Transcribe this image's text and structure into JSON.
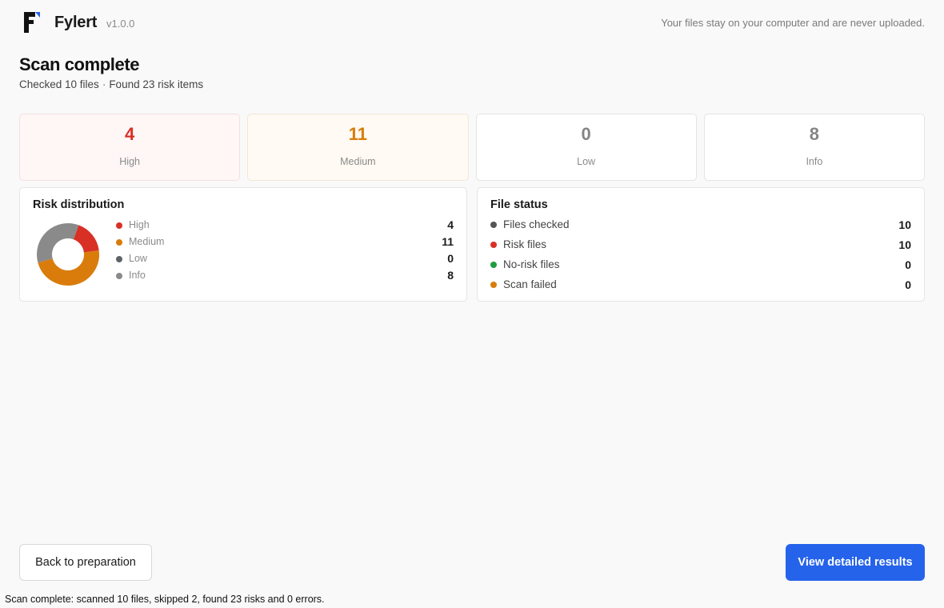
{
  "header": {
    "app_name": "Fylert",
    "version": "v1.0.0",
    "privacy_note": "Your files stay on your computer and are never uploaded.",
    "logo_icon": "fylert-logo-icon"
  },
  "page": {
    "title": "Scan complete",
    "checked": "Checked 10 files",
    "separator": "·",
    "found": "Found 23 risk items"
  },
  "summary_cards": [
    {
      "value": "4",
      "label": "High",
      "color": "#d93025"
    },
    {
      "value": "11",
      "label": "Medium",
      "color": "#d97c0b"
    },
    {
      "value": "0",
      "label": "Low",
      "color": "#858585"
    },
    {
      "value": "8",
      "label": "Info",
      "color": "#858585"
    }
  ],
  "risk_distribution": {
    "title": "Risk distribution",
    "items": [
      {
        "label": "High",
        "value": "4",
        "color": "#d93025"
      },
      {
        "label": "Medium",
        "value": "11",
        "color": "#d97c0b"
      },
      {
        "label": "Low",
        "value": "0",
        "color": "#5f6368"
      },
      {
        "label": "Info",
        "value": "8",
        "color": "#8a8a8a"
      }
    ]
  },
  "chart_data": {
    "type": "pie",
    "categories": [
      "High",
      "Medium",
      "Low",
      "Info"
    ],
    "values": [
      4,
      11,
      0,
      8
    ],
    "colors": [
      "#d93025",
      "#d97c0b",
      "#5f6368",
      "#8a8a8a"
    ],
    "donut": true
  },
  "file_status": {
    "title": "File status",
    "items": [
      {
        "label": "Files checked",
        "value": "10",
        "color": "#555555"
      },
      {
        "label": "Risk files",
        "value": "10",
        "color": "#d93025"
      },
      {
        "label": "No-risk files",
        "value": "0",
        "color": "#1e9e3e"
      },
      {
        "label": "Scan failed",
        "value": "0",
        "color": "#d97c0b"
      }
    ]
  },
  "actions": {
    "back_label": "Back to preparation",
    "view_label": "View detailed results"
  },
  "status_bar": {
    "text": "Scan complete: scanned 10 files, skipped 2, found 23 risks and 0 errors."
  }
}
